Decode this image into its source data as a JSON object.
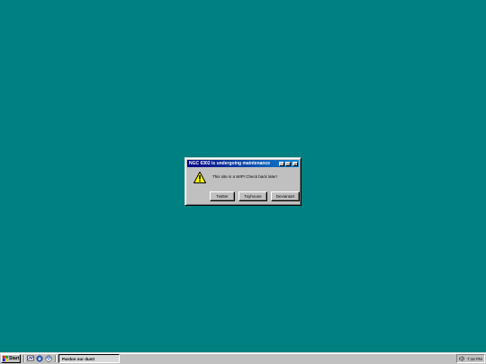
{
  "dialog": {
    "title": "NGC 6302 is undergoing maintenance",
    "title_buttons": {
      "minimize": "_",
      "maximize": "□",
      "close": "×"
    },
    "icon": "warning-icon",
    "message": "This site is a WIP! Check back later!",
    "buttons": [
      "Twitter",
      "Toyhouse",
      "Deviantart"
    ]
  },
  "taskbar": {
    "start_label": "Start",
    "quick_launch": [
      "desktop-icon",
      "browser-icon",
      "channels-icon"
    ],
    "task_label": "Pardon our dust!",
    "clock": "7:16 PM",
    "tray_icon": "volume-icon"
  },
  "colors": {
    "desktop": "#008080",
    "title_start": "#000080",
    "title_end": "#1084d0",
    "face": "#c0c0c0"
  }
}
